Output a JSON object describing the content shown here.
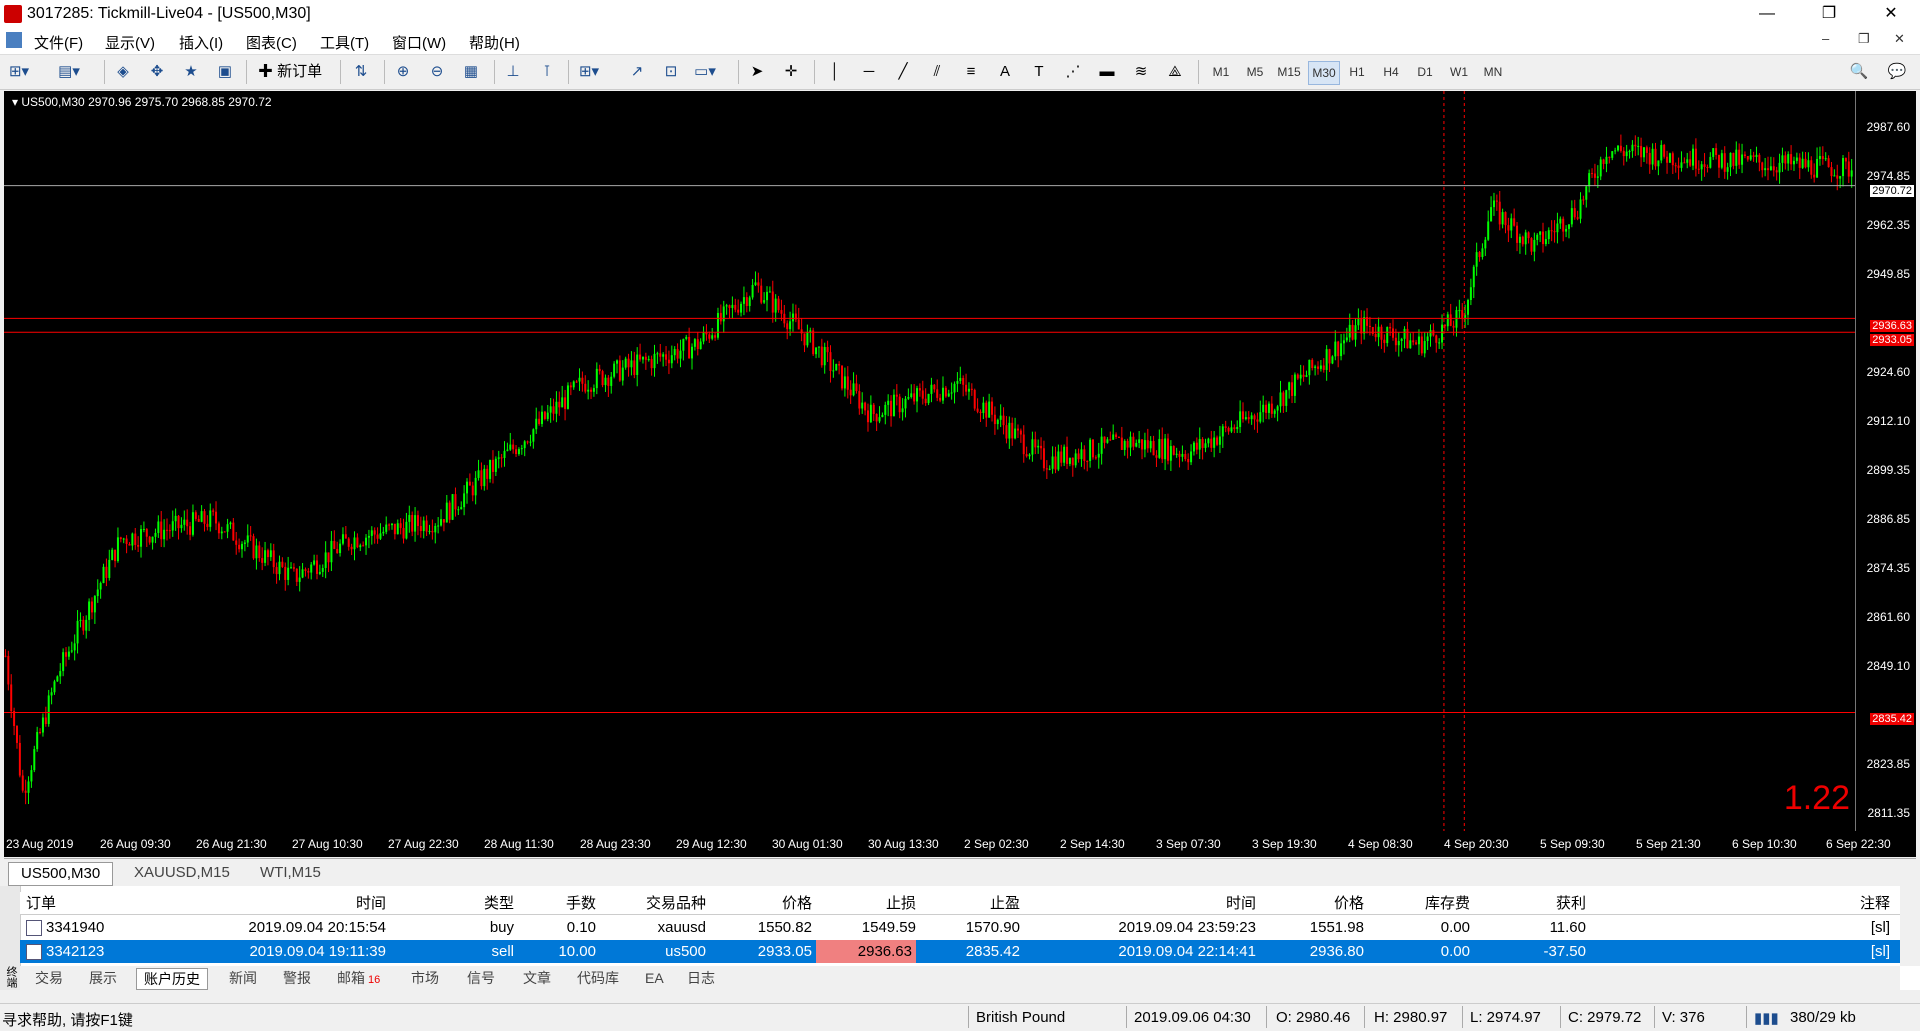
{
  "window": {
    "title": "3017285: Tickmill-Live04 - [US500,M30]",
    "min": "—",
    "max": "❐",
    "close": "✕"
  },
  "menu": [
    "文件(F)",
    "显示(V)",
    "插入(I)",
    "图表(C)",
    "工具(T)",
    "窗口(W)",
    "帮助(H)"
  ],
  "mdi": {
    "min": "–",
    "restore": "❐",
    "close": "✕"
  },
  "toolbar": {
    "new_order_label": "新订单",
    "timeframes": [
      "M1",
      "M5",
      "M15",
      "M30",
      "H1",
      "H4",
      "D1",
      "W1",
      "MN"
    ],
    "active_timeframe": "M30",
    "search_icon": "🔍"
  },
  "chart": {
    "info": "US500,M30  2970.96 2975.70 2968.85 2970.72",
    "bg": "#000000",
    "bull_color": "#00ff00",
    "bear_color": "#ff0000",
    "price_labels": [
      "2987.60",
      "2974.85",
      "2962.35",
      "2949.85",
      "2924.60",
      "2912.10",
      "2899.35",
      "2886.85",
      "2874.35",
      "2861.60",
      "2849.10",
      "2823.85",
      "2811.35"
    ],
    "tags": {
      "current": "2970.72",
      "sl": "2936.63",
      "open": "2933.05",
      "tp": "2835.42"
    },
    "time_labels": [
      "23 Aug 2019",
      "26 Aug 09:30",
      "26 Aug 21:30",
      "27 Aug 10:30",
      "27 Aug 22:30",
      "28 Aug 11:30",
      "28 Aug 23:30",
      "29 Aug 12:30",
      "30 Aug 01:30",
      "30 Aug 13:30",
      "2 Sep 02:30",
      "2 Sep 14:30",
      "3 Sep 07:30",
      "3 Sep 19:30",
      "4 Sep 08:30",
      "4 Sep 20:30",
      "5 Sep 09:30",
      "5 Sep 21:30",
      "6 Sep 10:30",
      "6 Sep 22:30"
    ],
    "big_value": "1.22"
  },
  "chart_data": {
    "type": "candlestick",
    "symbol": "US500",
    "timeframe": "M30",
    "ylim": [
      2805,
      2995
    ],
    "key_points": [
      [
        0,
        2850
      ],
      [
        6,
        2815
      ],
      [
        18,
        2845
      ],
      [
        40,
        2880
      ],
      [
        72,
        2885
      ],
      [
        100,
        2870
      ],
      [
        120,
        2880
      ],
      [
        150,
        2885
      ],
      [
        200,
        2920
      ],
      [
        240,
        2930
      ],
      [
        260,
        2945
      ],
      [
        280,
        2930
      ],
      [
        300,
        2912
      ],
      [
        330,
        2920
      ],
      [
        360,
        2900
      ],
      [
        390,
        2905
      ],
      [
        410,
        2902
      ],
      [
        440,
        2915
      ],
      [
        470,
        2935
      ],
      [
        490,
        2930
      ],
      [
        505,
        2937
      ],
      [
        515,
        2965
      ],
      [
        530,
        2955
      ],
      [
        545,
        2965
      ],
      [
        555,
        2980
      ],
      [
        580,
        2978
      ],
      [
        640,
        2975
      ]
    ],
    "current": 2970.72,
    "sl": 2936.63,
    "open": 2933.05,
    "tp": 2835.42
  },
  "chart_tabs": [
    "US500,M30",
    "XAUUSD,M15",
    "WTI,M15"
  ],
  "terminal": {
    "columns": [
      "订单",
      "时间",
      "类型",
      "手数",
      "交易品种",
      "价格",
      "止损",
      "止盈",
      "时间",
      "价格",
      "库存费",
      "获利",
      "注释"
    ],
    "rows": [
      {
        "order": "3341940",
        "time": "2019.09.04 20:15:54",
        "type": "buy",
        "lots": "0.10",
        "symbol": "xauusd",
        "price": "1550.82",
        "sl": "1549.59",
        "tp": "1570.90",
        "close_time": "2019.09.04 23:59:23",
        "close_price": "1551.98",
        "swap": "0.00",
        "profit": "11.60",
        "comment": "[sl]"
      },
      {
        "order": "3342123",
        "time": "2019.09.04 19:11:39",
        "type": "sell",
        "lots": "10.00",
        "symbol": "us500",
        "price": "2933.05",
        "sl": "2936.63",
        "tp": "2835.42",
        "close_time": "2019.09.04 22:14:41",
        "close_price": "2936.80",
        "swap": "0.00",
        "profit": "-37.50",
        "comment": "[sl]"
      }
    ],
    "side_label": "终端",
    "tabs": [
      "交易",
      "展示",
      "账户历史",
      "新闻",
      "警报",
      "邮箱",
      "市场",
      "信号",
      "文章",
      "代码库",
      "EA",
      "日志"
    ],
    "mail_count": "16",
    "active_tab": "账户历史"
  },
  "status": {
    "help": "寻求帮助, 请按F1键",
    "symbol_name": "British Pound",
    "datetime": "2019.09.06 04:30",
    "open": "O: 2980.46",
    "high": "H: 2980.97",
    "low": "L: 2974.97",
    "close": "C: 2979.72",
    "volume": "V: 376",
    "traffic": "380/29 kb"
  }
}
